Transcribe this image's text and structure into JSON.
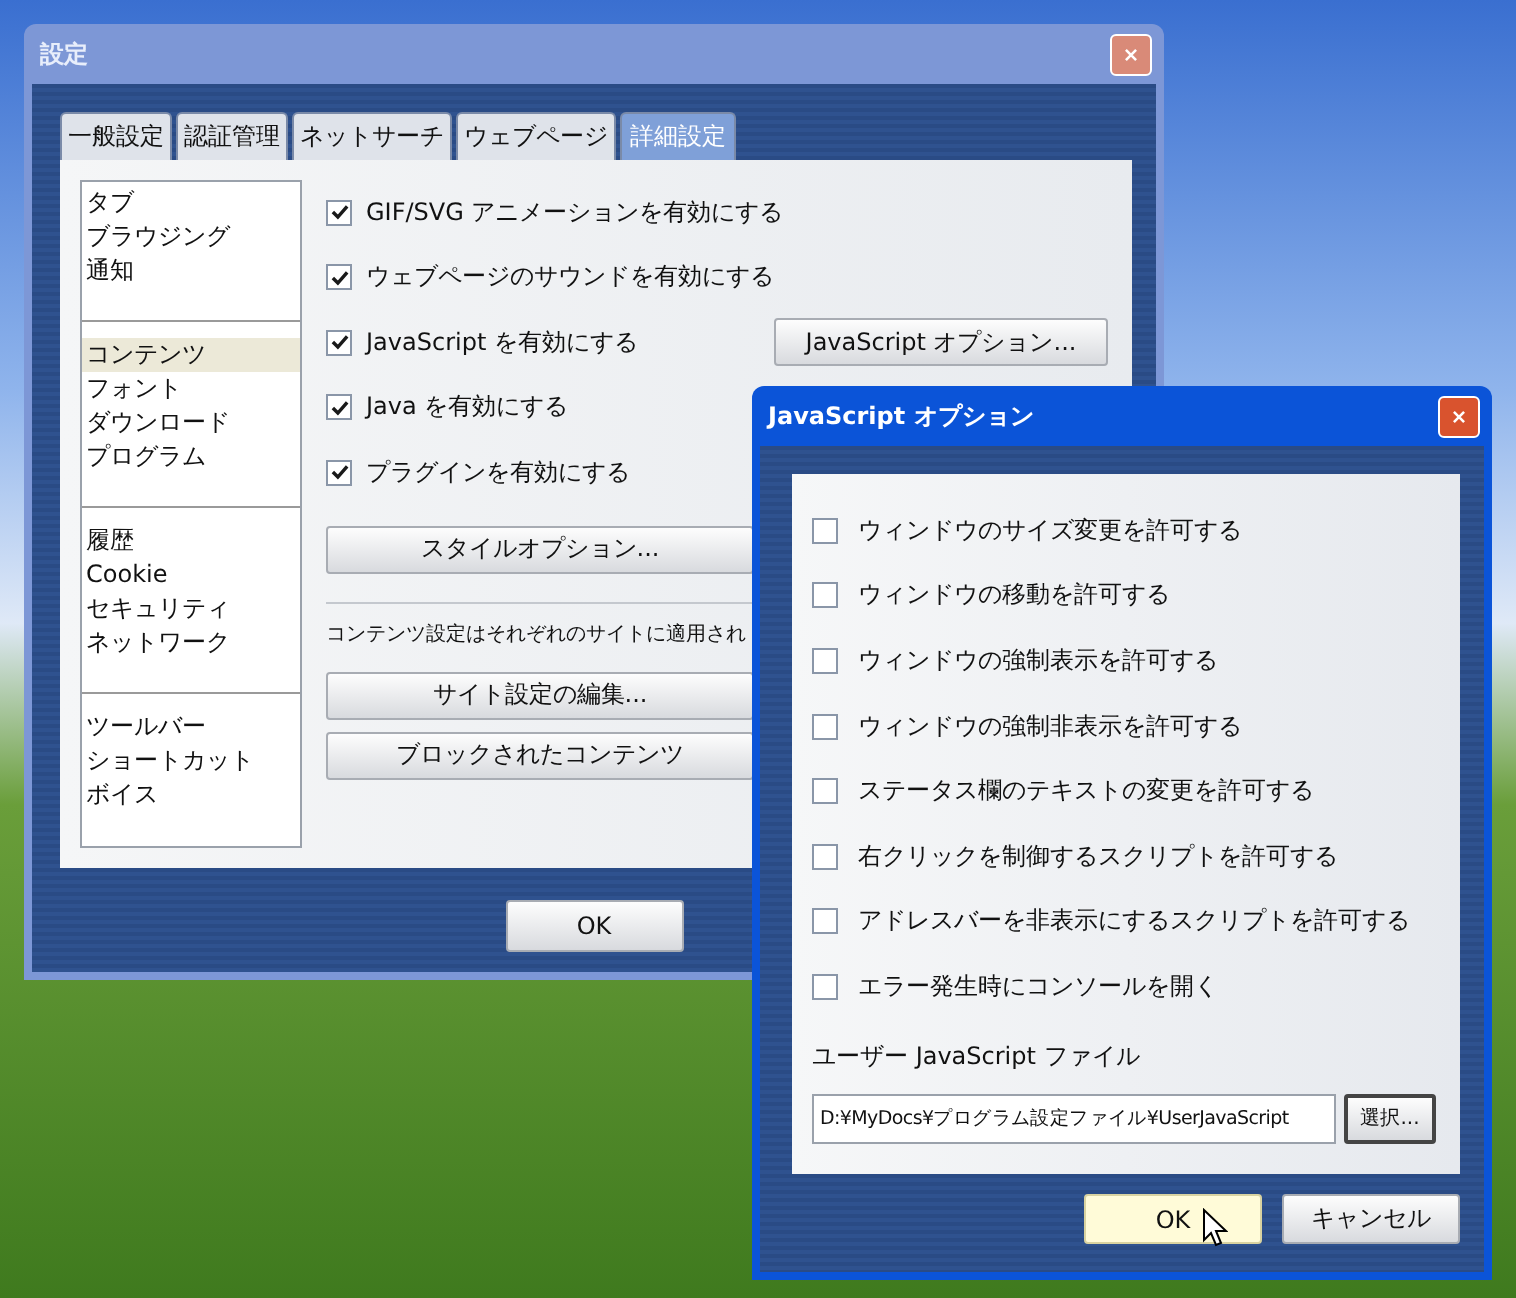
{
  "main_window": {
    "title": "設定",
    "tabs": [
      {
        "label": "一般設定",
        "selected": false
      },
      {
        "label": "認証管理",
        "selected": false
      },
      {
        "label": "ネットサーチ",
        "selected": false
      },
      {
        "label": "ウェブページ",
        "selected": false
      },
      {
        "label": "詳細設定",
        "selected": true
      }
    ],
    "sidebar_groups": [
      {
        "items": [
          {
            "label": "タブ",
            "selected": false
          },
          {
            "label": "ブラウジング",
            "selected": false
          },
          {
            "label": "通知",
            "selected": false
          }
        ]
      },
      {
        "items": [
          {
            "label": "コンテンツ",
            "selected": true
          },
          {
            "label": "フォント",
            "selected": false
          },
          {
            "label": "ダウンロード",
            "selected": false
          },
          {
            "label": "プログラム",
            "selected": false
          }
        ]
      },
      {
        "items": [
          {
            "label": "履歴",
            "selected": false
          },
          {
            "label": "Cookie",
            "selected": false
          },
          {
            "label": "セキュリティ",
            "selected": false
          },
          {
            "label": "ネットワーク",
            "selected": false
          }
        ]
      },
      {
        "items": [
          {
            "label": "ツールバー",
            "selected": false
          },
          {
            "label": "ショートカット",
            "selected": false
          },
          {
            "label": "ボイス",
            "selected": false
          }
        ]
      }
    ],
    "checkboxes": [
      {
        "label": "GIF/SVG アニメーションを有効にする",
        "checked": true
      },
      {
        "label": "ウェブページのサウンドを有効にする",
        "checked": true
      },
      {
        "label": "JavaScript を有効にする",
        "checked": true
      },
      {
        "label": "Java を有効にする",
        "checked": true
      },
      {
        "label": "プラグインを有効にする",
        "checked": true
      }
    ],
    "javascript_options_button": "JavaScript オプション...",
    "style_options_button": "スタイルオプション...",
    "content_note": "コンテンツ設定はそれぞれのサイトに適用され",
    "site_settings_button": "サイト設定の編集...",
    "blocked_content_button": "ブロックされたコンテンツ",
    "ok_button": "OK"
  },
  "js_dialog": {
    "title": "JavaScript オプション",
    "options": [
      {
        "label": "ウィンドウのサイズ変更を許可する",
        "checked": false
      },
      {
        "label": "ウィンドウの移動を許可する",
        "checked": false
      },
      {
        "label": "ウィンドウの強制表示を許可する",
        "checked": false
      },
      {
        "label": "ウィンドウの強制非表示を許可する",
        "checked": false
      },
      {
        "label": "ステータス欄のテキストの変更を許可する",
        "checked": false
      },
      {
        "label": "右クリックを制御するスクリプトを許可する",
        "checked": false
      },
      {
        "label": "アドレスバーを非表示にするスクリプトを許可する",
        "checked": false
      },
      {
        "label": "エラー発生時にコンソールを開く",
        "checked": false
      }
    ],
    "file_label": "ユーザー JavaScript ファイル",
    "file_path": "D:¥MyDocs¥プログラム設定ファイル¥UserJavaScript",
    "choose_button": "選択...",
    "ok_button": {
      "label": "OK",
      "hovered": true
    },
    "cancel_button": "キャンセル"
  }
}
